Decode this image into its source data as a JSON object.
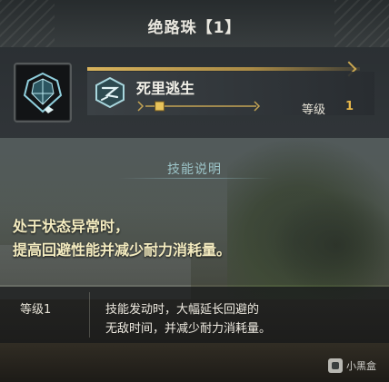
{
  "page_title": "绝路珠【1】",
  "jewel": {
    "icon": "diamond-jewel-icon",
    "color": "#7fc7d6"
  },
  "skill": {
    "icon": "evade-skill-icon",
    "name": "死里逃生",
    "level_label": "等级",
    "level_value": "1",
    "level_progress": 0.08
  },
  "description": {
    "heading": "技能说明",
    "lines": [
      "处于状态异常时，",
      "提高回避性能并减少耐力消耗量。"
    ]
  },
  "levels": [
    {
      "label": "等级1",
      "lines": [
        "技能发动时，大幅延长回避的",
        "无敌时间，并减少耐力消耗量。"
      ]
    }
  ],
  "watermark": {
    "icon": "heybox-logo-icon",
    "text": "小黑盒"
  },
  "colors": {
    "accent_gold": "#e8b84a",
    "heading_teal": "#9cc4c8",
    "desc_text": "#f4ecc0"
  }
}
